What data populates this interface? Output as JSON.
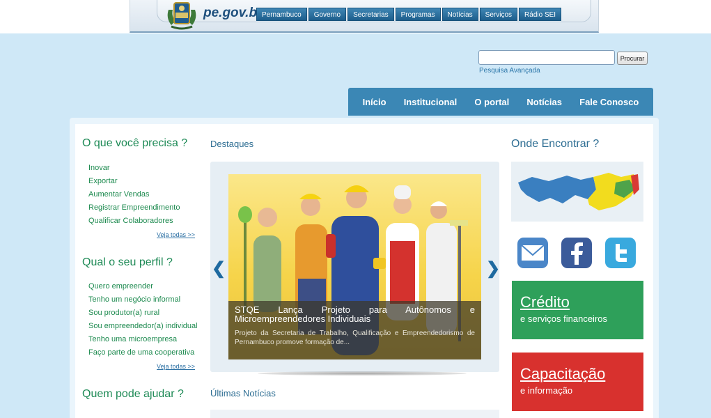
{
  "govbar": {
    "logo_text": "pe.gov.br",
    "nav": [
      "Pernambuco",
      "Governo",
      "Secretarias",
      "Programas",
      "Notícias",
      "Serviços",
      "Rádio SEI"
    ]
  },
  "search": {
    "value": "",
    "button_label": "Procurar",
    "advanced_link": "Pesquisa Avançada"
  },
  "mainnav": [
    "Início",
    "Institucional",
    "O portal",
    "Notícias",
    "Fale Conosco"
  ],
  "left": {
    "need_title": "O que você precisa ?",
    "need_items": [
      "Inovar",
      "Exportar",
      "Aumentar Vendas",
      "Registrar Empreendimento",
      "Qualificar Colaboradores"
    ],
    "see_all_1": "Veja todas >>",
    "profile_title": "Qual o seu perfil ?",
    "profile_items": [
      "Quero empreender",
      "Tenho um negócio informal",
      "Sou produtor(a) rural",
      "Sou empreendedor(a) individual",
      "Tenho uma microempresa",
      "Faço parte de uma cooperativa"
    ],
    "see_all_2": "Veja todas >>",
    "help_title": "Quem pode ajudar ?"
  },
  "center": {
    "highlights_title": "Destaques",
    "slide_title": "STQE Lança Projeto para Autônomos e Microempreendedores Individuais",
    "slide_text": "Projeto da Secretaria de Trabalho, Qualificação e Empreendedorismo de Pernambuco promove formação de...",
    "prev_arrow": "❮",
    "next_arrow": "❯",
    "news_title": "Últimas Notícias"
  },
  "right": {
    "where_title": "Onde Encontrar ?",
    "social": [
      {
        "icon": "email-icon",
        "color": "#4a86c8"
      },
      {
        "icon": "facebook-icon",
        "color": "#3b5b9a"
      },
      {
        "icon": "twitter-icon",
        "color": "#39a9de"
      }
    ],
    "credit": {
      "title": "Crédito",
      "subtitle": "e serviços financeiros",
      "color": "#2ea05a"
    },
    "training": {
      "title": "Capacitação",
      "subtitle": "e informação",
      "color": "#d8312e"
    }
  }
}
